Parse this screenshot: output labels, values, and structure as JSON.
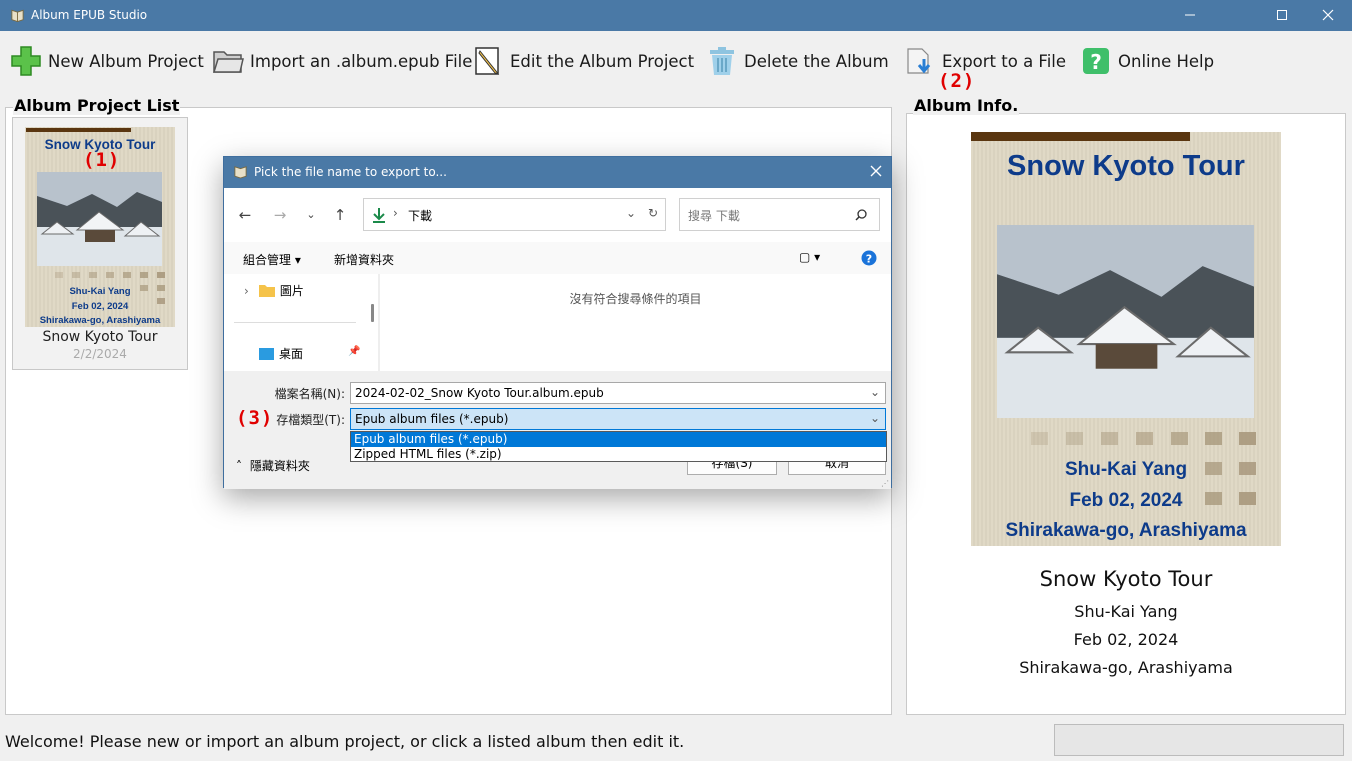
{
  "window": {
    "title": "Album EPUB Studio"
  },
  "toolbar": {
    "new_label": "New Album Project",
    "import_label": "Import an .album.epub File",
    "edit_label": "Edit the Album Project",
    "delete_label": "Delete the Album",
    "export_label": "Export to a File",
    "help_label": "Online Help"
  },
  "annotations": {
    "a1": "(1)",
    "a2": "(2)",
    "a3": "(3)"
  },
  "project_list": {
    "title": "Album Project List",
    "albums": [
      {
        "name": "Snow Kyoto Tour",
        "date": "2/2/2024",
        "cover_title": "Snow Kyoto Tour",
        "cover_author": "Shu-Kai Yang",
        "cover_date": "Feb 02, 2024",
        "cover_place": "Shirakawa-go, Arashiyama"
      }
    ]
  },
  "album_info": {
    "title": "Album Info.",
    "cover_title": "Snow Kyoto Tour",
    "cover_author": "Shu-Kai Yang",
    "cover_date": "Feb 02, 2024",
    "cover_place": "Shirakawa-go, Arashiyama",
    "name": "Snow Kyoto Tour",
    "author": "Shu-Kai Yang",
    "date": "Feb 02, 2024",
    "place": "Shirakawa-go, Arashiyama"
  },
  "status": {
    "message": "Welcome! Please new or import an album project, or click a listed album then edit it."
  },
  "dialog": {
    "title": "Pick the file name to export to...",
    "address": "下載",
    "search_placeholder": "搜尋 下載",
    "organize": "組合管理",
    "new_folder": "新增資料夾",
    "nav_items": [
      {
        "label": "圖片"
      },
      {
        "label": "桌面"
      }
    ],
    "empty_message": "沒有符合搜尋條件的項目",
    "filename_label": "檔案名稱(N):",
    "filename_value": "2024-02-02_Snow Kyoto Tour.album.epub",
    "filetype_label": "存檔類型(T):",
    "filetype_value": "Epub album files (*.epub)",
    "filetype_options": [
      "Epub album files (*.epub)",
      "Zipped HTML files (*.zip)"
    ],
    "hide_folders": "隱藏資料夾",
    "save_button": "存檔(S)",
    "cancel_button": "取消"
  },
  "colors": {
    "titlebar": "#4a79a6",
    "cover_text": "#0d3b8a",
    "annotation": "#e00000",
    "highlight": "#0078d7"
  }
}
